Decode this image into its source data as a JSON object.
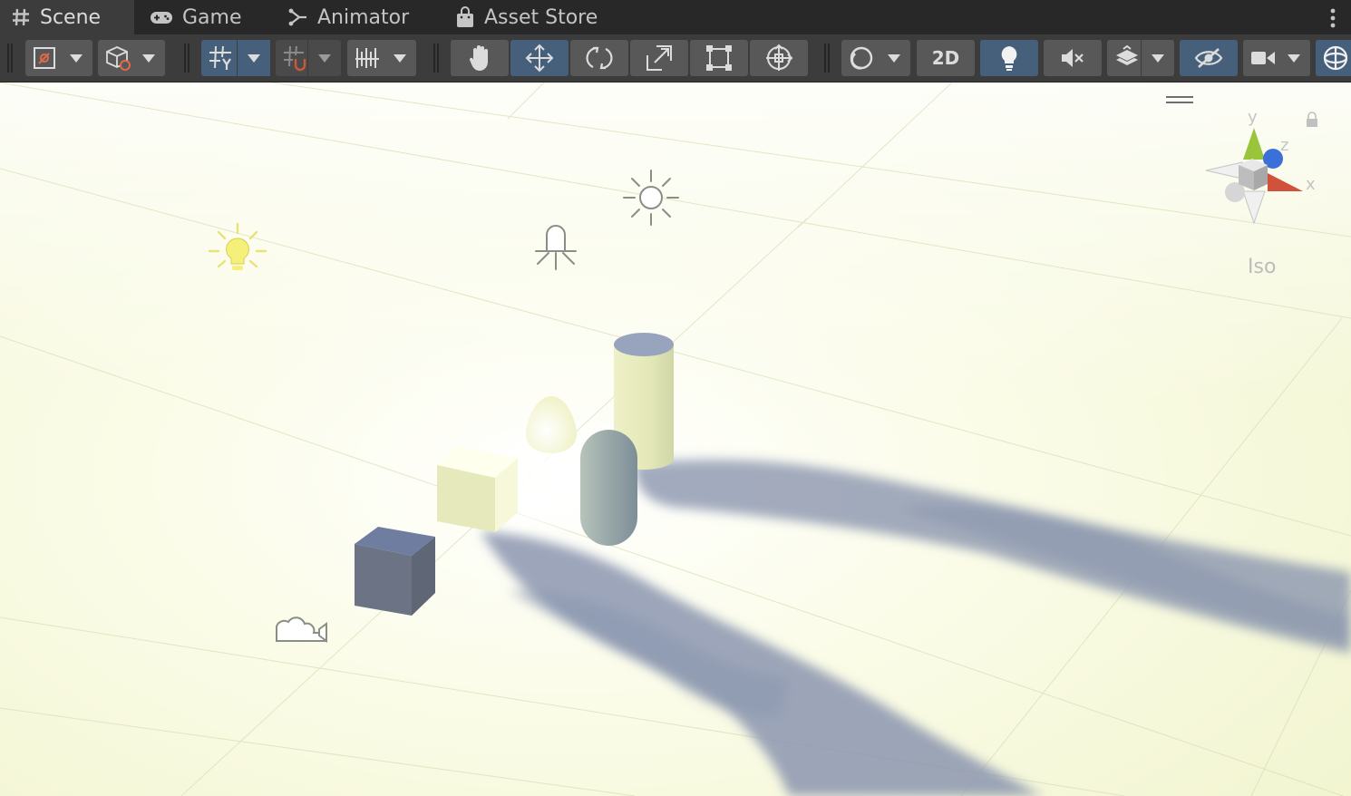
{
  "tabs": [
    {
      "id": "scene",
      "label": "Scene",
      "icon": "hash-icon",
      "active": true
    },
    {
      "id": "game",
      "label": "Game",
      "icon": "gamepad-icon",
      "active": false
    },
    {
      "id": "animator",
      "label": "Animator",
      "icon": "animator-icon",
      "active": false
    },
    {
      "id": "asset_store",
      "label": "Asset Store",
      "icon": "shopping-bag-icon",
      "active": false
    }
  ],
  "toolbar": {
    "two_d_label": "2D",
    "tools": [
      "view-tool",
      "move-tool",
      "rotate-tool",
      "scale-tool",
      "rect-tool",
      "transform-tool"
    ],
    "active_tool": "move-tool",
    "lighting_enabled": true,
    "grid_snapping_enabled": true,
    "hidden_objects_toggle_on": true
  },
  "scene_gizmo": {
    "axes": {
      "y": "y",
      "z": "z",
      "x": "x"
    },
    "projection_label": "Iso",
    "axis_colors": {
      "x": "#d0523a",
      "y": "#9ac43a",
      "z": "#3a70d8"
    }
  },
  "colors": {
    "tab_bar": "#282828",
    "toolbar": "#3c3c3c",
    "button": "#585858",
    "button_active": "#46607c",
    "light_icon": "#f5f07a",
    "shadow": "#8a94ad",
    "ground": "#f4f6d2"
  }
}
